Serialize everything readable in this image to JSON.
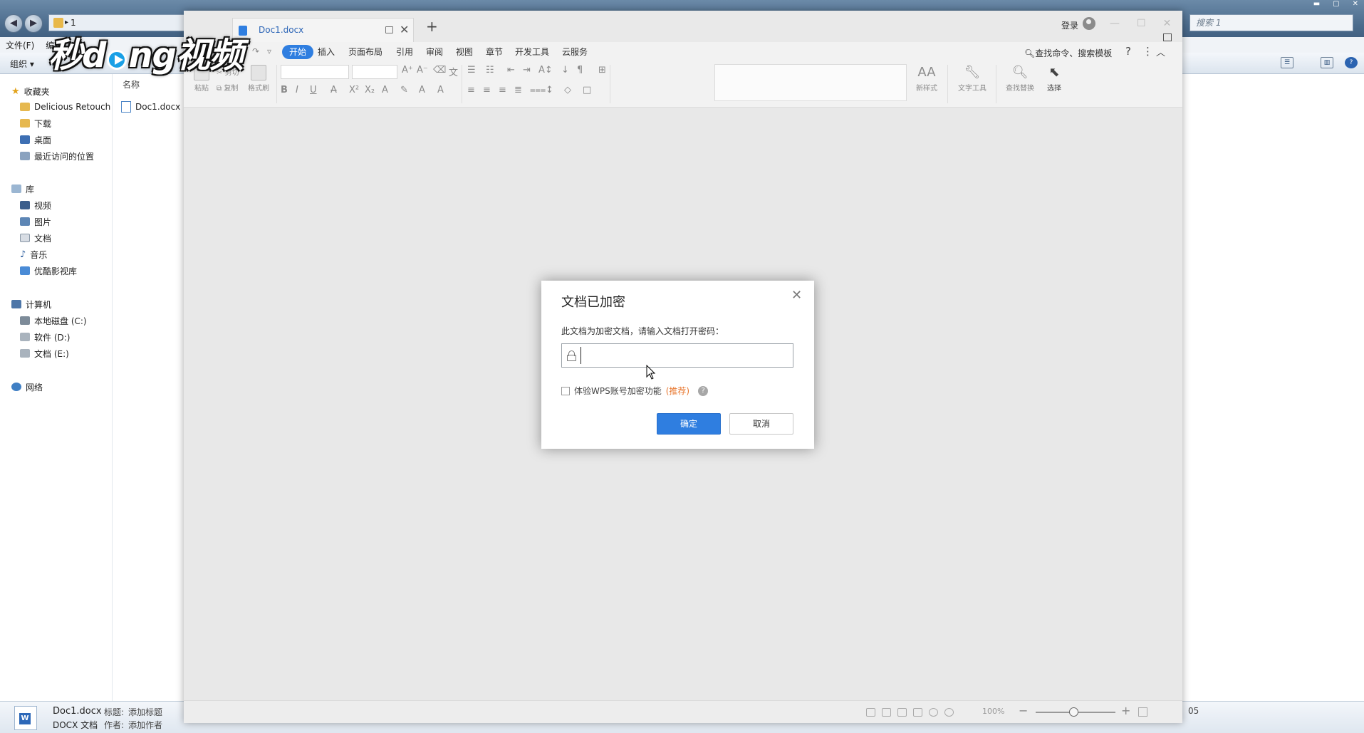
{
  "explorer": {
    "address_text": "1",
    "search_placeholder": "搜索 1",
    "menubar": [
      "文件(F)",
      "编辑"
    ],
    "toolbar_organize": "组织 ▾",
    "favorites": {
      "header": "收藏夹",
      "items": [
        "Delicious Retouch",
        "下载",
        "桌面",
        "最近访问的位置"
      ]
    },
    "library": {
      "header": "库",
      "items": [
        "视频",
        "图片",
        "文档",
        "音乐",
        "优酷影视库"
      ]
    },
    "computer": {
      "header": "计算机",
      "items": [
        "本地磁盘 (C:)",
        "软件 (D:)",
        "文档 (E:)"
      ]
    },
    "network": "网络",
    "column_header": "名称",
    "file_item": "Doc1.docx",
    "details": {
      "filename": "Doc1.docx",
      "title_label": "标题:",
      "title_value": "添加标题",
      "filetype": "DOCX 文档",
      "author_label": "作者:",
      "author_value": "添加作者",
      "fragment_right": "05"
    }
  },
  "watermark": {
    "part1": "秒d",
    "part2": "ng视频"
  },
  "wps": {
    "tab_title": "Doc1.docx",
    "new_tab": "+",
    "login": "登录",
    "menu_tabs": [
      "开始",
      "插入",
      "页面布局",
      "引用",
      "审阅",
      "视图",
      "章节",
      "开发工具",
      "云服务"
    ],
    "active_tab": "开始",
    "search_hint": "查找命令、搜索模板",
    "ribbon": {
      "paste": "粘贴",
      "cut": "剪切",
      "copy": "复制",
      "format_painter": "格式刷",
      "new_style": "新样式",
      "text_tools": "文字工具",
      "find_replace": "查找替换",
      "select": "选择"
    },
    "status": {
      "zoom": "100%",
      "zoom_level": 0.48
    }
  },
  "dialog": {
    "title": "文档已加密",
    "prompt": "此文档为加密文档，请输入文档打开密码：",
    "password_value": "",
    "checkbox_label": "体验WPS账号加密功能",
    "checkbox_recommend": "(推荐)",
    "checkbox_checked": false,
    "ok_label": "确定",
    "cancel_label": "取消",
    "accent_color": "#2f7ee0"
  }
}
